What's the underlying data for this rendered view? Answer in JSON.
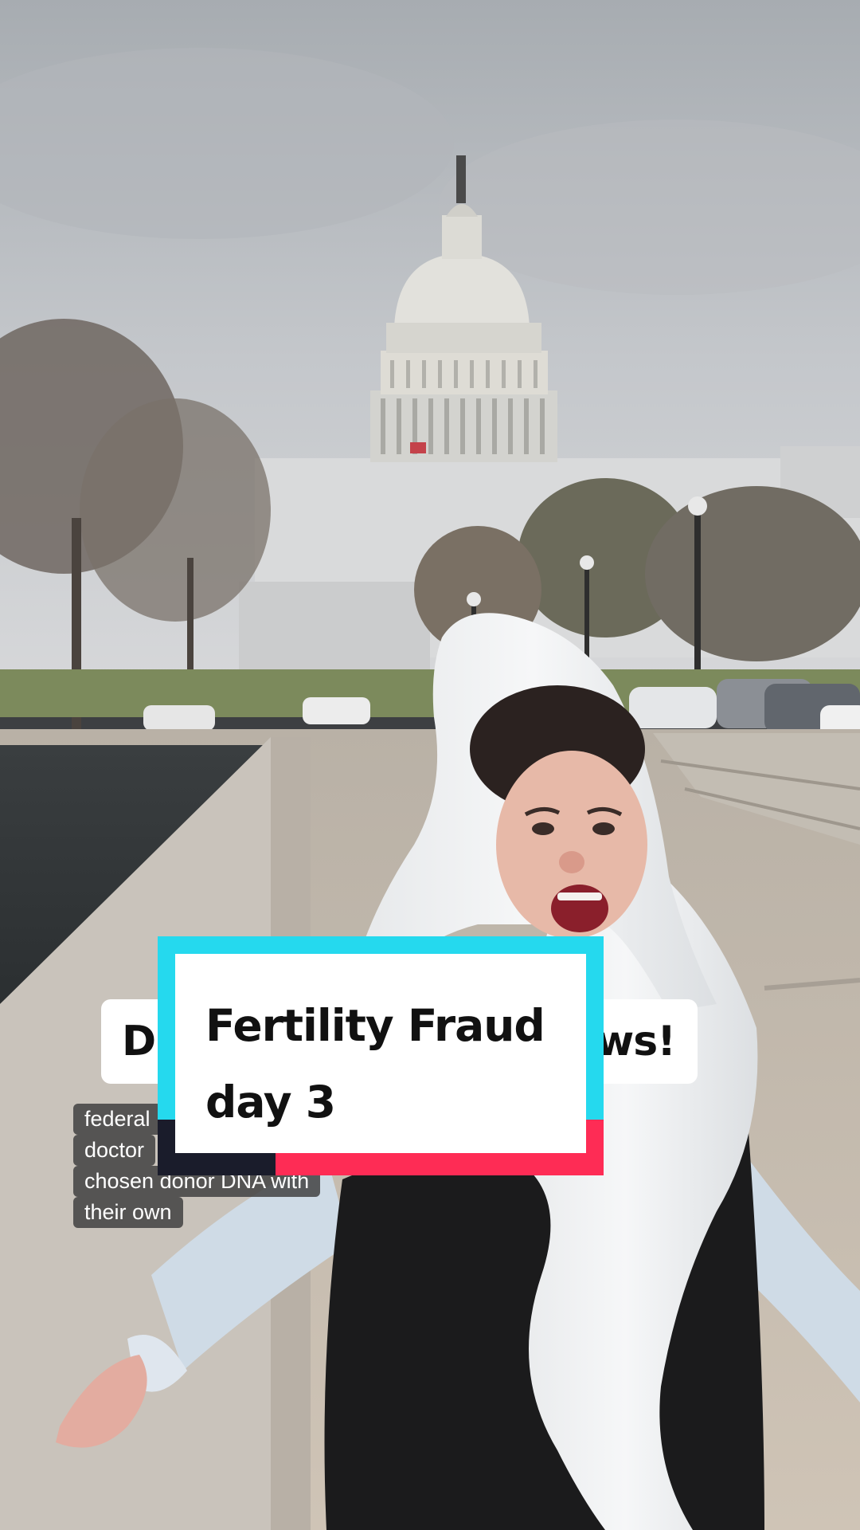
{
  "sticker_text": {
    "left": "D",
    "middle": "",
    "right": "ws!"
  },
  "caption": {
    "lines": [
      "federal",
      "doctor",
      "chosen donor DNA with",
      "their own"
    ]
  },
  "title_card": {
    "line1": "Fertility Fraud",
    "line2": "day 3"
  },
  "colors": {
    "cyan_accent": "#25d9ee",
    "red_accent": "#fe2c55",
    "dark_accent": "#1a1c2b"
  }
}
